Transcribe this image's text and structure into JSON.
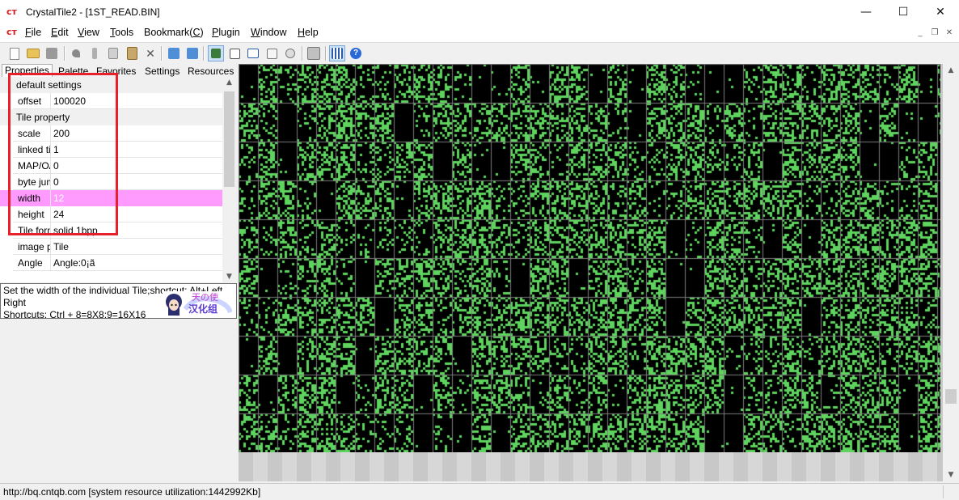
{
  "window": {
    "title": "CrystalTile2 - [1ST_READ.BIN]",
    "app_icon_glyph": "ᴄᴛ",
    "minimize_glyph": "—",
    "maximize_glyph": "☐",
    "close_glyph": "✕"
  },
  "menu": {
    "items": [
      {
        "pre": "",
        "u": "F",
        "post": "ile"
      },
      {
        "pre": "",
        "u": "E",
        "post": "dit"
      },
      {
        "pre": "",
        "u": "V",
        "post": "iew"
      },
      {
        "pre": "",
        "u": "T",
        "post": "ools"
      },
      {
        "pre": "Bookmark(",
        "u": "C",
        "post": ")"
      },
      {
        "pre": "",
        "u": "P",
        "post": "lugin"
      },
      {
        "pre": "",
        "u": "W",
        "post": "indow"
      },
      {
        "pre": "",
        "u": "H",
        "post": "elp"
      }
    ],
    "mdi_minimize_glyph": "_",
    "mdi_restore_glyph": "❐",
    "mdi_close_glyph": "✕"
  },
  "toolbar": {
    "icons": [
      "new-file-icon",
      "open-folder-icon",
      "save-icon",
      "undo-icon",
      "cut-icon",
      "copy-icon",
      "paste-icon",
      "delete-icon",
      "import-icon",
      "export-icon",
      "tile-view-icon",
      "hex-view-icon",
      "text-view-icon",
      "edit-icon",
      "search-icon",
      "print-icon",
      "grid-icon",
      "help-icon"
    ]
  },
  "tabs": [
    "Properties",
    "Palette",
    "Favorites",
    "Settings",
    "Resources"
  ],
  "properties": {
    "sections": {
      "default_settings": "default settings",
      "tile_property": "Tile property"
    },
    "rows": [
      {
        "key": "offset",
        "value": "100020"
      },
      {
        "key": "scale",
        "value": "200"
      },
      {
        "key": "linked tile",
        "value": "1"
      },
      {
        "key": "MAP/OAM",
        "value": "0"
      },
      {
        "key": "byte jump",
        "value": "0"
      },
      {
        "key": "width",
        "value": "12"
      },
      {
        "key": "height",
        "value": "24"
      },
      {
        "key": "Tile format",
        "value": "solid 1bpp"
      },
      {
        "key": "image pos",
        "value": "Tile"
      },
      {
        "key": "Angle",
        "value": "Angle:0¡ã"
      }
    ],
    "selected_row": "width",
    "selected_color": "#ff9aff"
  },
  "scroll": {
    "up_glyph": "▲",
    "down_glyph": "▼"
  },
  "description": {
    "text": "Set the width of the individual Tile;shortcut: Alt+Left, Right",
    "shortcuts": "Shortcuts: Ctrl + 8=8X8;9=16X16",
    "badge_top": "天の使",
    "badge_bottom": "汉化组"
  },
  "viewer": {
    "tile_color": "#5ed35e",
    "background_color": "#000000",
    "grid_color": "#7a7a7a"
  },
  "annotation": {
    "highlight_color": "#e8202a"
  },
  "status": {
    "text": "http://bq.cntqb.com [system resource utilization:1442992Kb]"
  }
}
